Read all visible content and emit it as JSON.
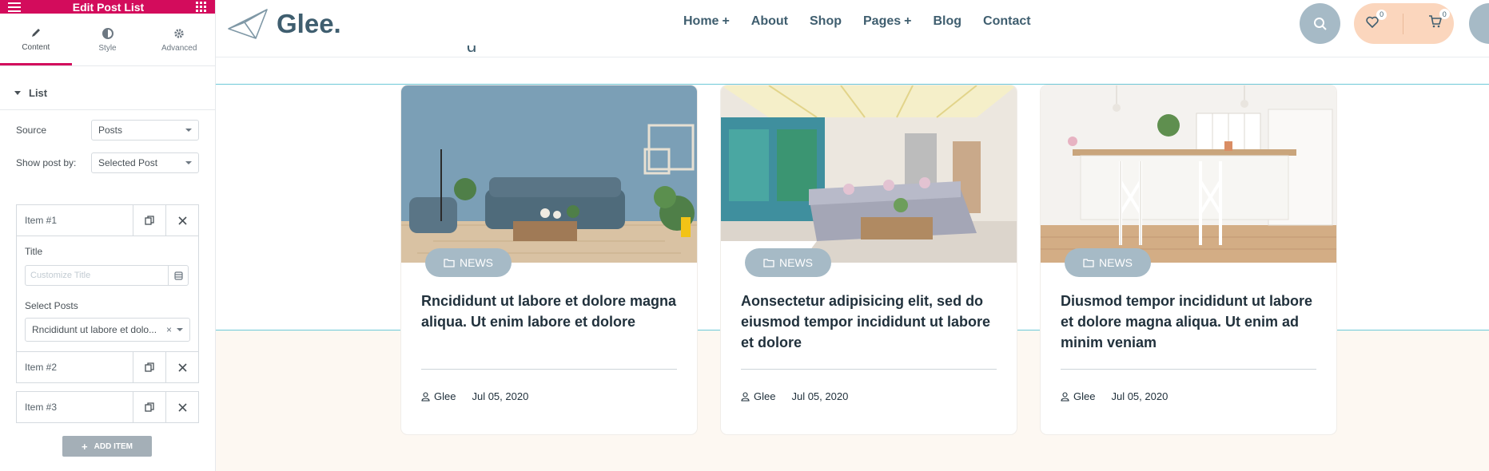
{
  "editor": {
    "title": "Edit Post List",
    "tabs": [
      {
        "label": "Content",
        "icon": "pencil-icon"
      },
      {
        "label": "Style",
        "icon": "half-circle-icon"
      },
      {
        "label": "Advanced",
        "icon": "gear-icon"
      }
    ],
    "section_label": "List",
    "source": {
      "label": "Source",
      "value": "Posts"
    },
    "show_post_by": {
      "label": "Show post by:",
      "value": "Selected Post"
    },
    "items": [
      {
        "label": "Item #1",
        "expanded": true,
        "title_label": "Title",
        "title_placeholder": "Customize Title",
        "select_label": "Select Posts",
        "select_value": "Rncididunt ut labore et dolo..."
      },
      {
        "label": "Item #2"
      },
      {
        "label": "Item #3"
      }
    ],
    "add_item_label": "ADD ITEM"
  },
  "site": {
    "logo_text": "Glee.",
    "menu": [
      {
        "label": "Home",
        "has_plus": true
      },
      {
        "label": "About"
      },
      {
        "label": "Shop"
      },
      {
        "label": "Pages",
        "has_plus": true
      },
      {
        "label": "Blog"
      },
      {
        "label": "Contact"
      }
    ],
    "wishlist_count": "0",
    "cart_count": "0",
    "colors": {
      "primary": "#3f5e6f",
      "accent_pink": "#d30c5c",
      "badge": "#a6bac6",
      "pill": "#fbd6bd"
    },
    "cards": [
      {
        "category": "NEWS",
        "title": "Rncididunt ut labore et dolore magna aliqua. Ut enim labore et dolore",
        "author": "Glee",
        "date": "Jul 05, 2020"
      },
      {
        "category": "NEWS",
        "title": "Aonsectetur adipisicing elit, sed do eiusmod tempor incididunt ut labore et dolore",
        "author": "Glee",
        "date": "Jul 05, 2020"
      },
      {
        "category": "NEWS",
        "title": "Diusmod tempor incididunt ut labore et dolore magna aliqua. Ut enim ad minim veniam",
        "author": "Glee",
        "date": "Jul 05, 2020"
      }
    ]
  }
}
